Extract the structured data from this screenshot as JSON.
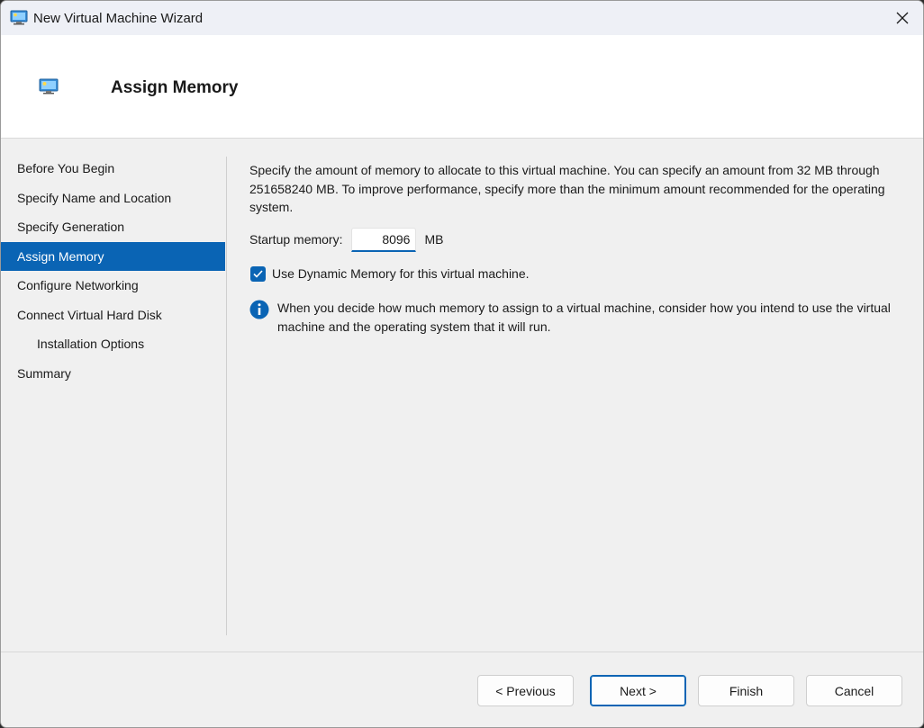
{
  "window": {
    "title": "New Virtual Machine Wizard"
  },
  "header": {
    "title": "Assign Memory"
  },
  "nav": {
    "items": [
      {
        "label": "Before You Begin"
      },
      {
        "label": "Specify Name and Location"
      },
      {
        "label": "Specify Generation"
      },
      {
        "label": "Assign Memory",
        "active": true
      },
      {
        "label": "Configure Networking"
      },
      {
        "label": "Connect Virtual Hard Disk"
      },
      {
        "label": "Installation Options",
        "indent": true
      },
      {
        "label": "Summary"
      }
    ]
  },
  "content": {
    "description": "Specify the amount of memory to allocate to this virtual machine. You can specify an amount from 32 MB through 251658240 MB. To improve performance, specify more than the minimum amount recommended for the operating system.",
    "startup_memory_label": "Startup memory:",
    "startup_memory_value": "8096",
    "startup_memory_unit": "MB",
    "dynamic_memory_label": "Use Dynamic Memory for this virtual machine.",
    "dynamic_memory_checked": true,
    "info_text": "When you decide how much memory to assign to a virtual machine, consider how you intend to use the virtual machine and the operating system that it will run."
  },
  "buttons": {
    "previous": "< Previous",
    "next": "Next >",
    "finish": "Finish",
    "cancel": "Cancel"
  },
  "colors": {
    "accent": "#0a64b4",
    "window_bg": "#f0f0f0",
    "header_bg": "#ffffff"
  },
  "icons": {
    "title": "monitor-icon",
    "header": "monitor-icon",
    "close": "close-icon",
    "check": "checkmark-icon",
    "info": "info-icon"
  }
}
